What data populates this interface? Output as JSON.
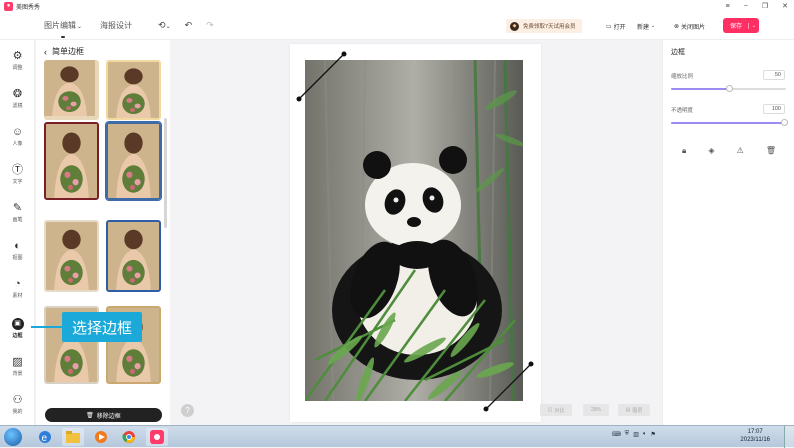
{
  "app": {
    "title": "美图秀秀"
  },
  "toolbar": {
    "tabs": [
      "图片编辑",
      "海报设计"
    ],
    "promo": "免费领取7天试用会员",
    "open": "打开",
    "new": "新建",
    "close_image": "关闭图片",
    "save": "保存"
  },
  "rail": {
    "items": [
      "调整",
      "滤镜",
      "人像",
      "文字",
      "画笔",
      "抠图",
      "素材",
      "边框",
      "背景",
      "我的"
    ]
  },
  "panel": {
    "title": "简单边框",
    "remove_button": "移除边框"
  },
  "callout": {
    "text": "选择边框"
  },
  "canvas": {
    "help": "?",
    "compare": "对比",
    "zoom": "28%",
    "layers": "图层"
  },
  "right_panel": {
    "title": "边框",
    "scale_label": "缩放比例",
    "scale_value": "50",
    "opacity_label": "不透明度",
    "opacity_value": "100",
    "scale_fraction": 0.5,
    "opacity_fraction": 1.0
  },
  "taskbar": {
    "time": "17:07",
    "date": "2023/11/16"
  },
  "colors": {
    "accent": "#ff2e63",
    "callout": "#1aa9d8",
    "slider": "#9a8cf0"
  }
}
